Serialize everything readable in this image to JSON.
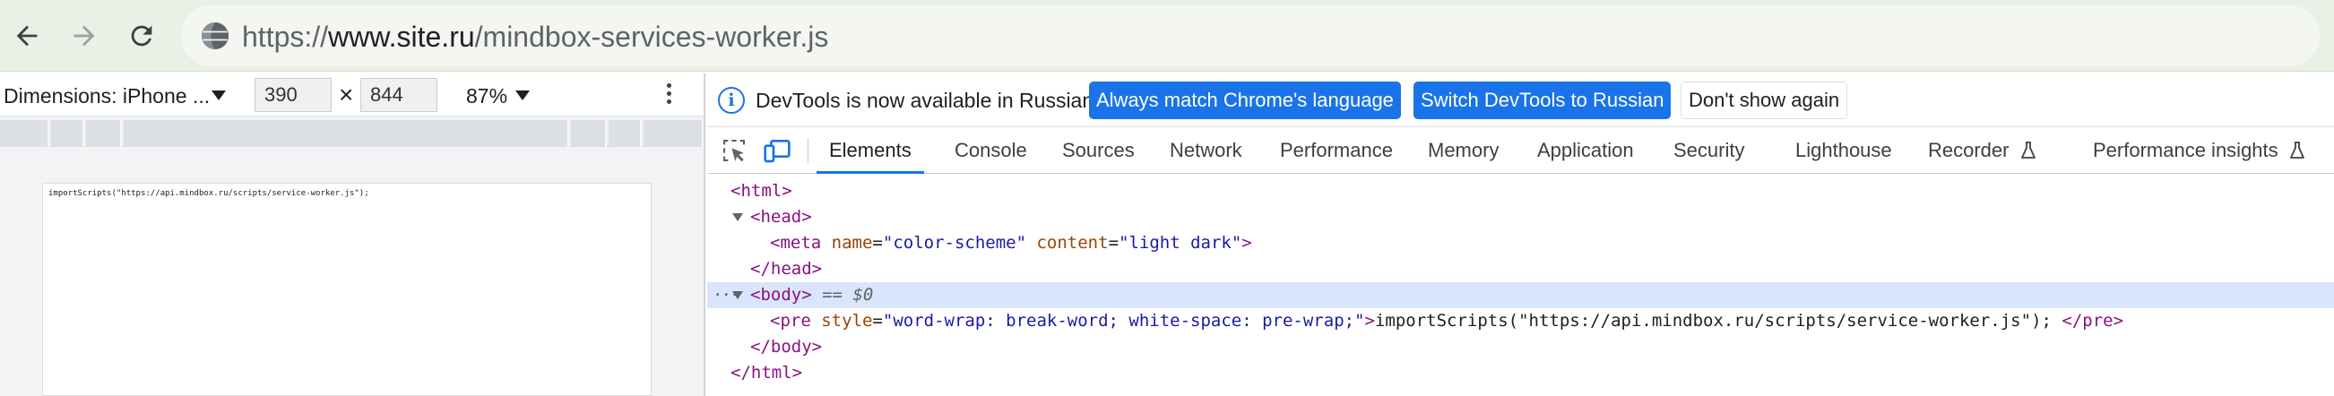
{
  "browser": {
    "url_scheme": "https://",
    "url_host": "www.site.ru",
    "url_path": "/mindbox-services-worker.js"
  },
  "device_toolbar": {
    "dimensions_label": "Dimensions: iPhone ...",
    "width": "390",
    "times": "×",
    "height": "844",
    "zoom": "87%"
  },
  "device_content": {
    "text": "importScripts(\"https://api.mindbox.ru/scripts/service-worker.js\");"
  },
  "devtools": {
    "infobar": {
      "message": "DevTools is now available in Russian!",
      "btn_match": "Always match Chrome's language",
      "btn_switch": "Switch DevTools to Russian",
      "btn_dismiss": "Don't show again"
    },
    "tabs": [
      "Elements",
      "Console",
      "Sources",
      "Network",
      "Performance",
      "Memory",
      "Application",
      "Security",
      "Lighthouse",
      "Recorder",
      "Performance insights"
    ],
    "active_tab": "Elements",
    "dom": {
      "html_open": "<html>",
      "head_open": "<head>",
      "meta_tag": "<meta",
      "meta_attr1_name": "name",
      "meta_attr1_value": "\"color-scheme\"",
      "meta_attr2_name": "content",
      "meta_attr2_value": "\"light dark\"",
      "meta_close": ">",
      "head_close": "</head>",
      "body_open": "<body>",
      "body_eq": "==",
      "body_var": "$0",
      "pre_open": "<pre",
      "pre_attr_name": "style",
      "pre_attr_value": "\"word-wrap: break-word; white-space: pre-wrap;\"",
      "pre_gt": ">",
      "pre_text": "importScripts(\"https://api.mindbox.ru/scripts/service-worker.js\"); ",
      "pre_close": "</pre>",
      "body_close": "</body>",
      "html_close": "</html>"
    }
  },
  "colors": {
    "accent": "#1a73e8",
    "toolbar_bg": "#e9f0e6",
    "selected_row": "#d9e5fb",
    "tag": "#881280",
    "attr_name": "#994500",
    "attr_value": "#1a1aa6"
  }
}
